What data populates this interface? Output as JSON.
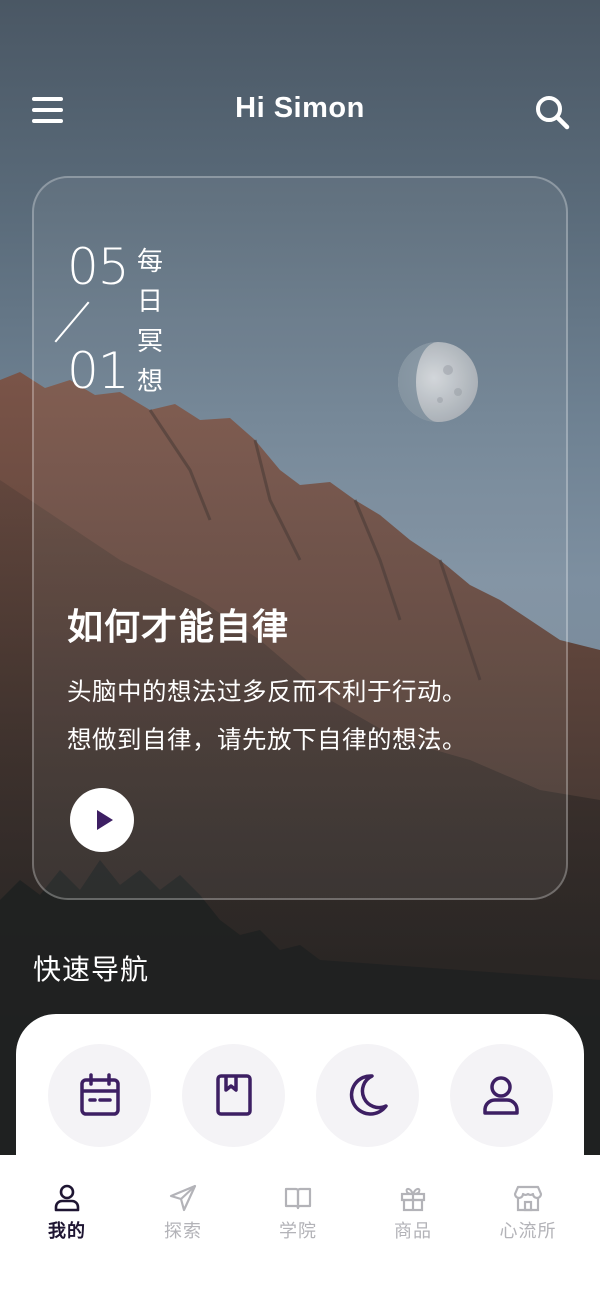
{
  "header": {
    "title": "Hi Simon",
    "menu_icon": "hamburger-menu-icon",
    "search_icon": "search-icon"
  },
  "card": {
    "date_month": "05",
    "date_day": "01",
    "daily_label": [
      "每",
      "日",
      "冥",
      "想"
    ],
    "title": "如何才能自律",
    "description_line1": "头脑中的想法过多反而不利于行动。",
    "description_line2": "想做到自律，请先放下自律的想法。",
    "play_icon": "play-icon"
  },
  "quick_nav": {
    "title": "快速导航",
    "items": [
      {
        "icon": "calendar-icon"
      },
      {
        "icon": "bookmark-book-icon"
      },
      {
        "icon": "moon-icon"
      },
      {
        "icon": "user-icon"
      }
    ]
  },
  "tabbar": {
    "tabs": [
      {
        "label": "我的",
        "icon": "user-icon",
        "active": true
      },
      {
        "label": "探索",
        "icon": "paper-plane-icon",
        "active": false
      },
      {
        "label": "学院",
        "icon": "open-book-icon",
        "active": false
      },
      {
        "label": "商品",
        "icon": "gift-icon",
        "active": false
      },
      {
        "label": "心流所",
        "icon": "store-icon",
        "active": false
      }
    ]
  },
  "colors": {
    "accent": "#3d1f63",
    "active_tab": "#1e1532",
    "inactive_tab": "#b3b3b8",
    "quick_item_bg": "#f4f3f6",
    "sky_top": "#4a5764",
    "sky_bottom": "#7d8fa0"
  }
}
